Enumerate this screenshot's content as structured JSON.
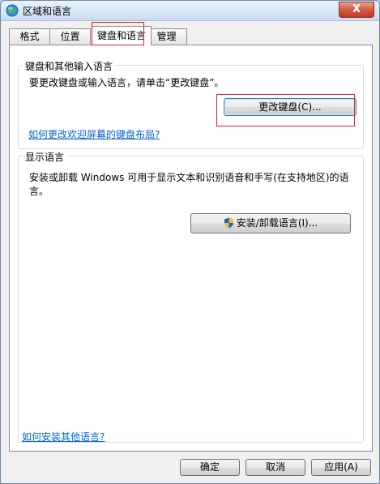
{
  "window": {
    "title": "区域和语言",
    "close_label": "X"
  },
  "tabs": [
    {
      "label": "格式",
      "active": false
    },
    {
      "label": "位置",
      "active": false
    },
    {
      "label": "键盘和语言",
      "active": true
    },
    {
      "label": "管理",
      "active": false
    }
  ],
  "keyboard_group": {
    "title": "键盘和其他输入语言",
    "description": "要更改键盘或输入语言，请单击“更改键盘”。",
    "change_keyboard_button": "更改键盘(C)...",
    "welcome_layout_link": "如何更改欢迎屏幕的键盘布局?"
  },
  "display_group": {
    "title": "显示语言",
    "description": "安装或卸载 Windows 可用于显示文本和识别语音和手写(在支持地区)的语言。",
    "install_button": "安装/卸载语言(I)..."
  },
  "footer": {
    "install_languages_link": "如何安装其他语言?",
    "ok_button": "确定",
    "cancel_button": "取消",
    "apply_button": "应用(A)"
  },
  "colors": {
    "link": "#0066cc",
    "highlight": "#d7262e"
  }
}
